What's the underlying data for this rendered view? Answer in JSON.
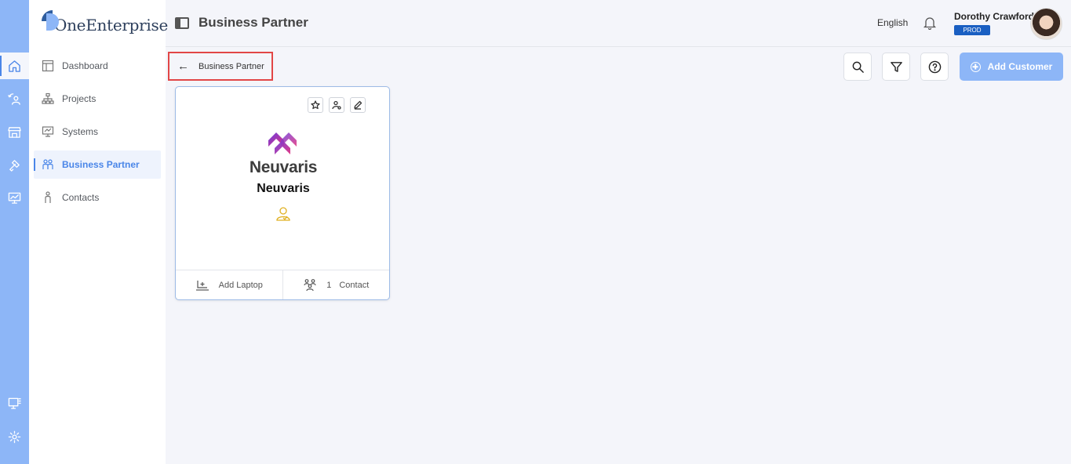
{
  "app": {
    "logo_text": "OneEnterprise",
    "page_title": "Business Partner"
  },
  "sidebar": {
    "items": [
      {
        "label": "Dashboard",
        "icon": "dashboard-icon"
      },
      {
        "label": "Projects",
        "icon": "hierarchy-icon"
      },
      {
        "label": "Systems",
        "icon": "systems-icon"
      },
      {
        "label": "Business Partner",
        "icon": "people-icon",
        "active": true
      },
      {
        "label": "Contacts",
        "icon": "person-icon"
      }
    ]
  },
  "rail": {
    "icons": [
      "home-icon",
      "user-swap-icon",
      "store-icon",
      "tools-icon",
      "monitor-chart-icon",
      "monitor-grid-icon",
      "settings-icon"
    ],
    "active": "home-icon"
  },
  "header": {
    "language": "English",
    "user_name": "Dorothy Crawford",
    "env_badge": "PROD"
  },
  "breadcrumb": {
    "label": "Business Partner"
  },
  "toolbar": {
    "add_label": "Add Customer"
  },
  "card": {
    "brand_word": "Neuvaris",
    "company_name": "Neuvaris",
    "footer_left_label": "Add Laptop",
    "contact_count": "1",
    "contact_label": "Contact"
  },
  "colors": {
    "rail": "#8db6f7",
    "accent": "#4a86e8",
    "badge": "#1a5fc2",
    "highlight_border": "#e24646",
    "owner_icon": "#e0b020"
  }
}
